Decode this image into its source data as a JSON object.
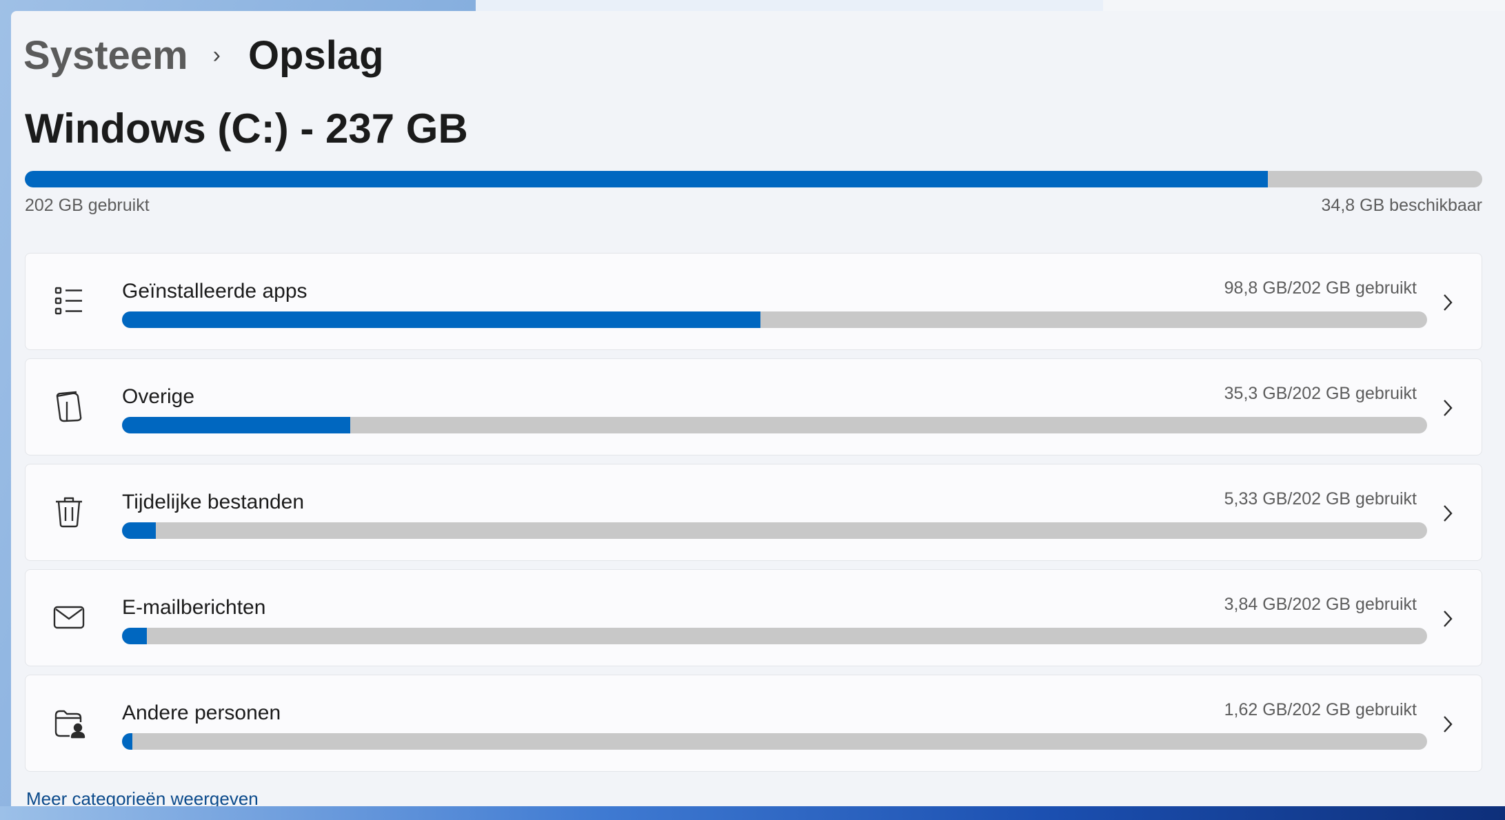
{
  "breadcrumb": {
    "parent": "Systeem",
    "separator": "›",
    "current": "Opslag"
  },
  "drive": {
    "title": "Windows (C:) - 237 GB",
    "used_label": "202 GB gebruikt",
    "free_label": "34,8 GB beschikbaar",
    "used_fraction": 0.853
  },
  "categories": [
    {
      "label": "Geïnstalleerde apps",
      "usage": "98,8 GB/202 GB gebruikt",
      "fraction": 0.489,
      "icon": "list-icon"
    },
    {
      "label": "Overige",
      "usage": "35,3 GB/202 GB gebruikt",
      "fraction": 0.175,
      "icon": "document-icon"
    },
    {
      "label": "Tijdelijke bestanden",
      "usage": "5,33 GB/202 GB gebruikt",
      "fraction": 0.026,
      "icon": "trash-icon"
    },
    {
      "label": "E-mailberichten",
      "usage": "3,84 GB/202 GB gebruikt",
      "fraction": 0.019,
      "icon": "mail-icon"
    },
    {
      "label": "Andere personen",
      "usage": "1,62 GB/202 GB gebruikt",
      "fraction": 0.008,
      "icon": "people-folder-icon"
    }
  ],
  "more_link": "Meer categorieën weergeven",
  "colors": {
    "accent": "#0067c0",
    "track": "#c8c8c8",
    "link": "#0b4a8b"
  }
}
